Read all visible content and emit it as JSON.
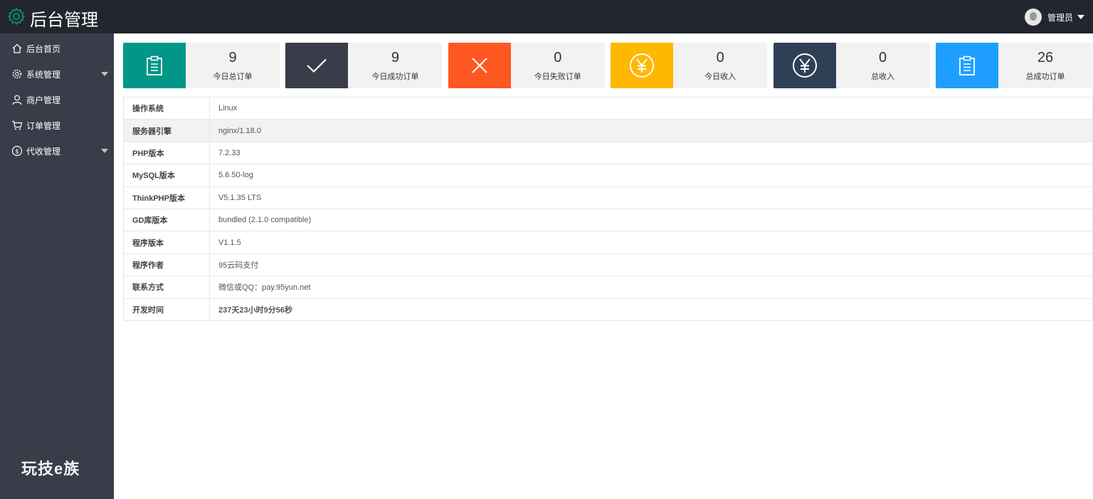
{
  "header": {
    "title": "后台管理",
    "user": "管理员"
  },
  "sidebar": {
    "items": [
      {
        "label": "后台首页",
        "icon": "home-icon",
        "has_arrow": false
      },
      {
        "label": "系统管理",
        "icon": "gear-icon",
        "has_arrow": true
      },
      {
        "label": "商户管理",
        "icon": "user-icon",
        "has_arrow": false
      },
      {
        "label": "订单管理",
        "icon": "cart-icon",
        "has_arrow": false
      },
      {
        "label": "代收管理",
        "icon": "dollar-icon",
        "has_arrow": true
      }
    ],
    "brand": "玩技e族"
  },
  "stats": [
    {
      "value": "9",
      "label": "今日总订单",
      "icon": "clipboard-icon",
      "color": "#009688"
    },
    {
      "value": "9",
      "label": "今日成功订单",
      "icon": "check-icon",
      "color": "#393d49"
    },
    {
      "value": "0",
      "label": "今日失败订单",
      "icon": "close-icon",
      "color": "#ff5722"
    },
    {
      "value": "0",
      "label": "今日收入",
      "icon": "yen-icon",
      "color": "#ffb800"
    },
    {
      "value": "0",
      "label": "总收入",
      "icon": "yen-icon",
      "color": "#2f4056"
    },
    {
      "value": "26",
      "label": "总成功订单",
      "icon": "clipboard-icon",
      "color": "#1e9fff"
    }
  ],
  "system_info": [
    {
      "key": "操作系统",
      "value": "Linux"
    },
    {
      "key": "服务器引擎",
      "value": "nginx/1.18.0"
    },
    {
      "key": "PHP版本",
      "value": "7.2.33"
    },
    {
      "key": "MySQL版本",
      "value": "5.6.50-log"
    },
    {
      "key": "ThinkPHP版本",
      "value": "V5.1.35 LTS"
    },
    {
      "key": "GD库版本",
      "value": "bundled (2.1.0 compatible)"
    },
    {
      "key": "程序版本",
      "value": "V1.1.5"
    },
    {
      "key": "程序作者",
      "value": "95云码支付"
    },
    {
      "key": "联系方式",
      "value": "微信或QQ：pay.95yun.net"
    },
    {
      "key": "开发时间",
      "value": "237天23小时9分56秒"
    }
  ],
  "colors": {
    "topbar": "#23262e",
    "sidebar": "#393d49",
    "gear_logo": "#009688",
    "highlight_text": "#d80000"
  }
}
